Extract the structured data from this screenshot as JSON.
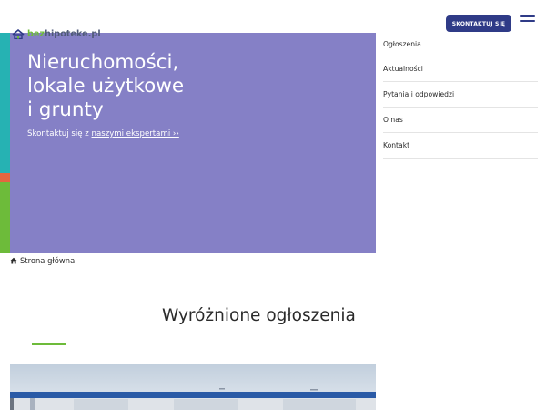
{
  "header": {
    "logo_prefix": "bez",
    "logo_name": "hipoteke.pl",
    "cta_label": "SKONTAKTUJ SIĘ"
  },
  "hero": {
    "title_lines": [
      "Nieruchomości,",
      "lokale użytkowe",
      "i grunty"
    ],
    "subtitle_prefix": "Skontaktuj się z ",
    "subtitle_link": "naszymi ekspertami ››",
    "background_color": "#8580c6",
    "stripe_colors": [
      "#26b2b3",
      "#e4663f",
      "#6dbb3a"
    ]
  },
  "menu": {
    "items": [
      {
        "label": "Ogłoszenia"
      },
      {
        "label": "Aktualności"
      },
      {
        "label": "Pytania i odpowiedzi"
      },
      {
        "label": "O nas"
      },
      {
        "label": "Kontakt"
      }
    ]
  },
  "breadcrumb": {
    "label": "Strona główna",
    "icon": "home-icon"
  },
  "featured": {
    "title": "Wyróżnione ogłoszenia",
    "accent_color": "#6dbb3a"
  },
  "colors": {
    "primary": "#2f3b87",
    "accent": "#6dbb3a"
  }
}
